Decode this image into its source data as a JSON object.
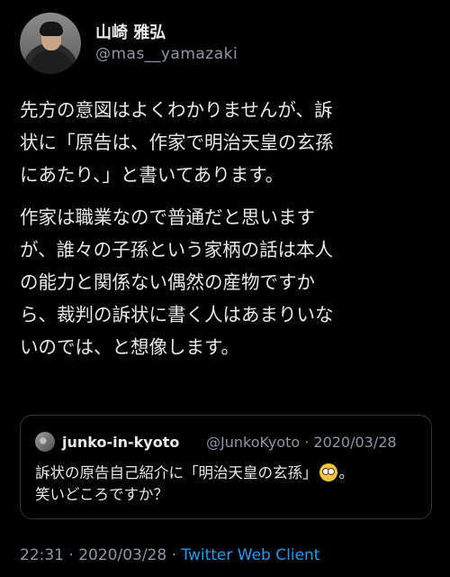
{
  "author": {
    "display_name": "山崎 雅弘",
    "handle": "@mas__yamazaki"
  },
  "tweet": {
    "paragraph1": "先方の意図はよくわかりませんが、訴\n状に「原告は、作家で明治天皇の玄孫\nにあたり、」と書いてあります。",
    "paragraph2": "作家は職業なので普通だと思います\nが、誰々の子孫という家柄の話は本人\nの能力と関係ない偶然の産物ですか\nら、裁判の訴状に書く人はあまりいな\nいのでは、と想像します。"
  },
  "quoted_tweet": {
    "name": "junko-in-kyoto",
    "meta": "@JunkoKyoto · 2020/03/28",
    "text_line1_before": "訴状の原告自己紹介に「明治天皇の玄孫」",
    "text_line1_after": "。",
    "text_line2": "笑いどころですか？",
    "emoji_icon": "flushed-face-icon"
  },
  "footer": {
    "time_date": "22:31 · 2020/03/28 · ",
    "client": "Twitter Web Client"
  },
  "colors": {
    "background": "#000000",
    "text": "#e7e9ea",
    "secondary": "#8b98a5",
    "link": "#1d9bf0",
    "border": "#333639"
  }
}
